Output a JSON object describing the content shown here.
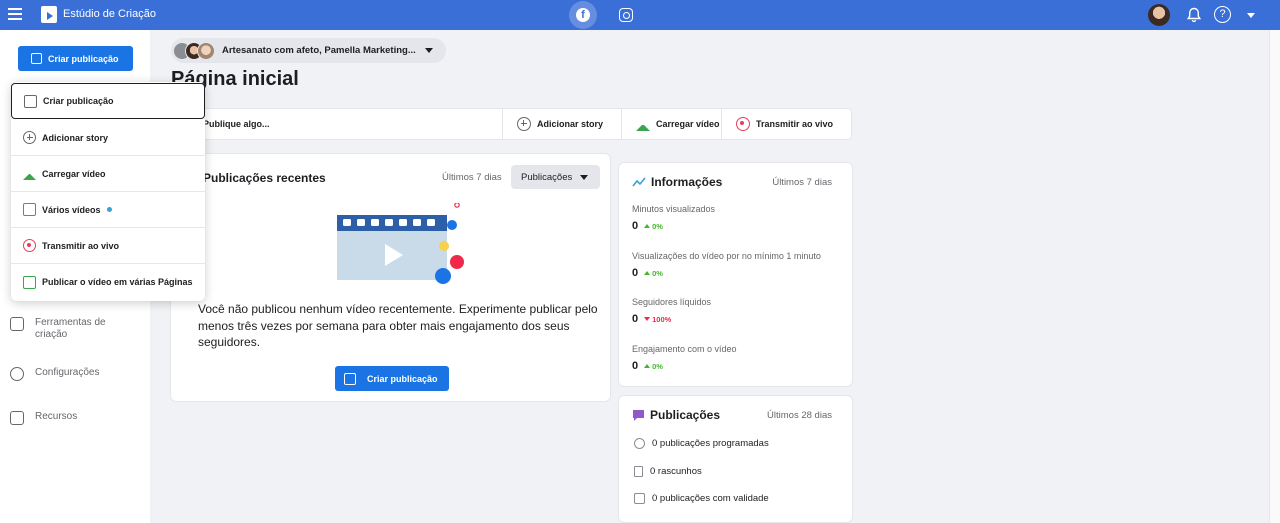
{
  "topbar": {
    "app_title": "Estúdio de Criação",
    "icons": [
      "menu-icon",
      "creator-studio-logo",
      "facebook-icon",
      "instagram-icon",
      "profile-avatar",
      "bell-icon",
      "help-icon",
      "chevron-down-icon"
    ],
    "help_glyph": "?",
    "fb_glyph": "f",
    "accent": "#3a6fd8"
  },
  "sidebar": {
    "create_button": "Criar publicação",
    "items": [
      {
        "label": "Ferramentas de criação",
        "icon": "tools-icon"
      },
      {
        "label": "Configurações",
        "icon": "settings-icon"
      },
      {
        "label": "Recursos",
        "icon": "resources-icon"
      }
    ]
  },
  "dropdown": {
    "items": [
      {
        "label": "Criar publicação",
        "icon": "pencil-icon",
        "active": true
      },
      {
        "label": "Adicionar story",
        "icon": "plus-circle-icon"
      },
      {
        "label": "Carregar vídeo",
        "icon": "upload-icon"
      },
      {
        "label": "Vários vídeos",
        "icon": "multiple-videos-icon",
        "new_dot": true
      },
      {
        "label": "Transmitir ao vivo",
        "icon": "live-icon"
      },
      {
        "label": "Publicar o vídeo em várias Páginas",
        "icon": "multi-page-video-icon"
      }
    ]
  },
  "header": {
    "page_name": "Artesanato com afeto, Pamella Marketing...",
    "title": "Página inicial"
  },
  "composer": {
    "placeholder": "Publique algo...",
    "buttons": [
      {
        "label": "Adicionar story",
        "icon": "plus-circle-icon"
      },
      {
        "label": "Carregar vídeo",
        "icon": "upload-icon"
      },
      {
        "label": "Transmitir ao vivo",
        "icon": "live-icon"
      }
    ]
  },
  "recent": {
    "title": "Publicações recentes",
    "period": "Últimos 7 dias",
    "type_select": "Publicações",
    "empty_message": "Você não publicou nenhum vídeo recentemente. Experimente publicar pelo menos três vezes por semana para obter mais engajamento dos seus seguidores.",
    "create_button": "Criar publicação"
  },
  "insights": {
    "title": "Informações",
    "period": "Últimos 7 dias",
    "metrics": [
      {
        "label": "Minutos visualizados",
        "value": "0",
        "change": "0%",
        "direction": "up"
      },
      {
        "label": "Visualizações do vídeo por no mínimo 1 minuto",
        "value": "0",
        "change": "0%",
        "direction": "up"
      },
      {
        "label": "Seguidores líquidos",
        "value": "0",
        "change": "100%",
        "direction": "down"
      },
      {
        "label": "Engajamento com o vídeo",
        "value": "0",
        "change": "0%",
        "direction": "up"
      }
    ]
  },
  "posts": {
    "title": "Publicações",
    "period": "Últimos 28 dias",
    "rows": [
      {
        "label": "0 publicações programadas",
        "icon": "clock-icon"
      },
      {
        "label": "0 rascunhos",
        "icon": "draft-icon"
      },
      {
        "label": "0 publicações com validade",
        "icon": "expiring-icon"
      }
    ]
  }
}
